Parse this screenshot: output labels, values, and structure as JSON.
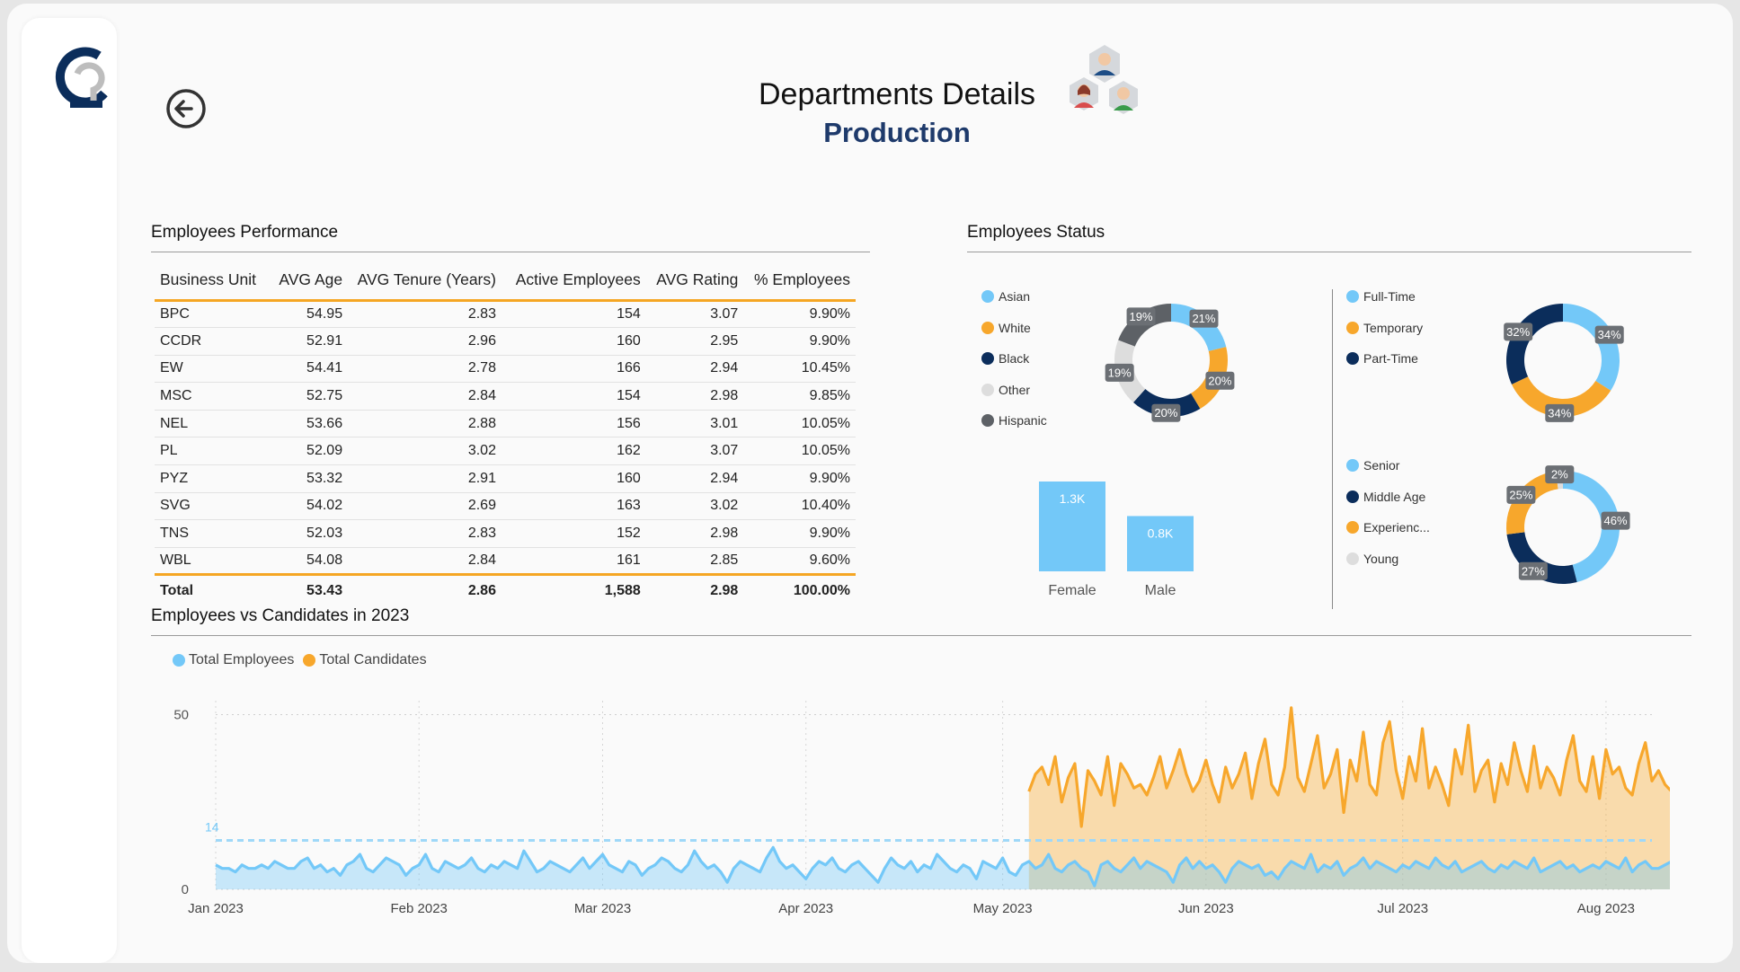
{
  "header": {
    "title": "Departments Details",
    "subtitle": "Production"
  },
  "colors": {
    "light_blue": "#73c8f8",
    "orange": "#f7a72c",
    "navy": "#0b2d5b",
    "light_gray": "#dddddd",
    "dark_gray": "#5d6166",
    "accent_line": "#f5a623"
  },
  "icons": {
    "back": "back-arrow-circle-icon",
    "logo": "company-logo",
    "people": "employees-group-icon"
  },
  "performance": {
    "title": "Employees Performance",
    "columns": [
      "Business Unit",
      "AVG Age",
      "AVG Tenure (Years)",
      "Active Employees",
      "AVG Rating",
      "% Employees"
    ],
    "rows": [
      [
        "BPC",
        "54.95",
        "2.83",
        "154",
        "3.07",
        "9.90%"
      ],
      [
        "CCDR",
        "52.91",
        "2.96",
        "160",
        "2.95",
        "9.90%"
      ],
      [
        "EW",
        "54.41",
        "2.78",
        "166",
        "2.94",
        "10.45%"
      ],
      [
        "MSC",
        "52.75",
        "2.84",
        "154",
        "2.98",
        "9.85%"
      ],
      [
        "NEL",
        "53.66",
        "2.88",
        "156",
        "3.01",
        "10.05%"
      ],
      [
        "PL",
        "52.09",
        "3.02",
        "162",
        "3.07",
        "10.05%"
      ],
      [
        "PYZ",
        "53.32",
        "2.91",
        "160",
        "2.94",
        "9.90%"
      ],
      [
        "SVG",
        "54.02",
        "2.69",
        "163",
        "3.02",
        "10.40%"
      ],
      [
        "TNS",
        "52.03",
        "2.83",
        "152",
        "2.98",
        "9.90%"
      ],
      [
        "WBL",
        "54.08",
        "2.84",
        "161",
        "2.85",
        "9.60%"
      ]
    ],
    "total": [
      "Total",
      "53.43",
      "2.86",
      "1,588",
      "2.98",
      "100.00%"
    ]
  },
  "status": {
    "title": "Employees Status",
    "ethnicity": {
      "legend": [
        {
          "label": "Asian",
          "color": "#73c8f8"
        },
        {
          "label": "White",
          "color": "#f7a72c"
        },
        {
          "label": "Black",
          "color": "#0b2d5b"
        },
        {
          "label": "Other",
          "color": "#dddddd"
        },
        {
          "label": "Hispanic",
          "color": "#5d6166"
        }
      ],
      "slices": [
        {
          "label": "Asian",
          "pct": 21,
          "text": "21%",
          "color": "#73c8f8"
        },
        {
          "label": "White",
          "pct": 20,
          "text": "20%",
          "color": "#f7a72c"
        },
        {
          "label": "Black",
          "pct": 20,
          "text": "20%",
          "color": "#0b2d5b"
        },
        {
          "label": "Other",
          "pct": 19,
          "text": "19%",
          "color": "#dddddd"
        },
        {
          "label": "Hispanic",
          "pct": 19,
          "text": "19%",
          "color": "#5d6166"
        }
      ]
    },
    "employment": {
      "legend": [
        {
          "label": "Full-Time",
          "color": "#73c8f8"
        },
        {
          "label": "Temporary",
          "color": "#f7a72c"
        },
        {
          "label": "Part-Time",
          "color": "#0b2d5b"
        }
      ],
      "slices": [
        {
          "label": "Full-Time",
          "pct": 34,
          "text": "34%",
          "color": "#73c8f8"
        },
        {
          "label": "Temporary",
          "pct": 34,
          "text": "34%",
          "color": "#f7a72c"
        },
        {
          "label": "Part-Time",
          "pct": 32,
          "text": "32%",
          "color": "#0b2d5b"
        }
      ]
    },
    "age_group": {
      "legend": [
        {
          "label": "Senior",
          "color": "#73c8f8"
        },
        {
          "label": "Middle Age",
          "color": "#0b2d5b"
        },
        {
          "label": "Experienc...",
          "color": "#f7a72c"
        },
        {
          "label": "Young",
          "color": "#dddddd"
        }
      ],
      "slices": [
        {
          "label": "Senior",
          "pct": 46,
          "text": "46%",
          "color": "#73c8f8"
        },
        {
          "label": "Middle Age",
          "pct": 27,
          "text": "27%",
          "color": "#0b2d5b"
        },
        {
          "label": "Experienc...",
          "pct": 25,
          "text": "25%",
          "color": "#f7a72c"
        },
        {
          "label": "Young",
          "pct": 2,
          "text": "2%",
          "color": "#dddddd"
        }
      ]
    },
    "gender": {
      "bars": [
        {
          "label": "Female",
          "value": 1.3,
          "text": "1.3K"
        },
        {
          "label": "Male",
          "value": 0.8,
          "text": "0.8K"
        }
      ]
    }
  },
  "trend": {
    "title": "Employees vs Candidates in 2023",
    "legend": [
      {
        "label": "Total Employees",
        "color": "#73c8f8"
      },
      {
        "label": "Total Candidates",
        "color": "#f7a72c"
      }
    ],
    "y_ticks": [
      "50",
      "0"
    ],
    "ref_label": "14",
    "x_ticks": [
      "Jan 2023",
      "Feb 2023",
      "Mar 2023",
      "Apr 2023",
      "May 2023",
      "Jun 2023",
      "Jul 2023",
      "Aug 2023"
    ]
  },
  "chart_data": {
    "type": "area",
    "title": "Employees vs Candidates in 2023",
    "xlabel": "",
    "ylabel": "",
    "ylim": [
      0,
      54
    ],
    "x_range": [
      "2023-01-01",
      "2023-08-08"
    ],
    "reference_line": {
      "value": 14,
      "label": "14",
      "style": "dashed"
    },
    "grid": true,
    "legend_position": "top-left",
    "series": [
      {
        "name": "Total Employees",
        "color": "#73c8f8",
        "start": "2023-01-01",
        "values": [
          7,
          6,
          6,
          5,
          7,
          6,
          6,
          7,
          6,
          8,
          7,
          6,
          6,
          8,
          9,
          6,
          7,
          5,
          6,
          4,
          7,
          8,
          10,
          6,
          5,
          7,
          9,
          8,
          7,
          4,
          6,
          7,
          10,
          6,
          5,
          8,
          7,
          6,
          7,
          9,
          6,
          5,
          7,
          6,
          8,
          7,
          6,
          11,
          8,
          5,
          6,
          8,
          7,
          6,
          5,
          7,
          9,
          6,
          8,
          10,
          7,
          6,
          5,
          8,
          7,
          4,
          6,
          7,
          9,
          8,
          6,
          5,
          7,
          11,
          8,
          6,
          7,
          5,
          2,
          6,
          8,
          7,
          6,
          5,
          9,
          12,
          8,
          6,
          7,
          5,
          3,
          6,
          8,
          7,
          9,
          6,
          5,
          7,
          8,
          6,
          4,
          2,
          6,
          9,
          7,
          6,
          8,
          5,
          7,
          6,
          10,
          8,
          6,
          5,
          7,
          6,
          3,
          8,
          7,
          6,
          9,
          5,
          4,
          7,
          8,
          6,
          7,
          10,
          6,
          5,
          7,
          8,
          6,
          5,
          1,
          7,
          8,
          6,
          5,
          7,
          9,
          6,
          8,
          7,
          6,
          5,
          2,
          7,
          9,
          6,
          8,
          6,
          7,
          5,
          2,
          6,
          8,
          7,
          6,
          7,
          4,
          5,
          3,
          6,
          8,
          7,
          6,
          10,
          5,
          7,
          6,
          8,
          4,
          6,
          7,
          9,
          6,
          8,
          7,
          6,
          5,
          7,
          6,
          8,
          7,
          6,
          9,
          7,
          6,
          8,
          5,
          6,
          7,
          8,
          6,
          5,
          7,
          6,
          8,
          7,
          6,
          9,
          5,
          6,
          7,
          8,
          6,
          7,
          5,
          6,
          7,
          6,
          8,
          7,
          6,
          9,
          5,
          7,
          8,
          6,
          6,
          7,
          8,
          6,
          7,
          9,
          6,
          5,
          7,
          8,
          6,
          7,
          9,
          5
        ]
      },
      {
        "name": "Total Candidates",
        "color": "#f7a72c",
        "start": "2023-05-05",
        "values": [
          28,
          33,
          35,
          30,
          38,
          25,
          32,
          36,
          18,
          34,
          31,
          27,
          38,
          24,
          36,
          33,
          29,
          30,
          27,
          32,
          38,
          29,
          34,
          40,
          33,
          28,
          31,
          37,
          30,
          25,
          35,
          29,
          33,
          39,
          26,
          36,
          43,
          30,
          27,
          35,
          52,
          32,
          28,
          36,
          44,
          29,
          33,
          40,
          22,
          37,
          31,
          45,
          30,
          27,
          42,
          48,
          34,
          26,
          38,
          31,
          46,
          29,
          35,
          30,
          24,
          40,
          33,
          47,
          28,
          34,
          37,
          25,
          36,
          30,
          42,
          34,
          28,
          41,
          29,
          35,
          32,
          27,
          37,
          44,
          31,
          28,
          38,
          26,
          40,
          33,
          35,
          29,
          27,
          36,
          42,
          31,
          34,
          30,
          28,
          38,
          33,
          26,
          35,
          29,
          37,
          32,
          28,
          36,
          33,
          30,
          34,
          31,
          29,
          35,
          32
        ]
      }
    ]
  }
}
